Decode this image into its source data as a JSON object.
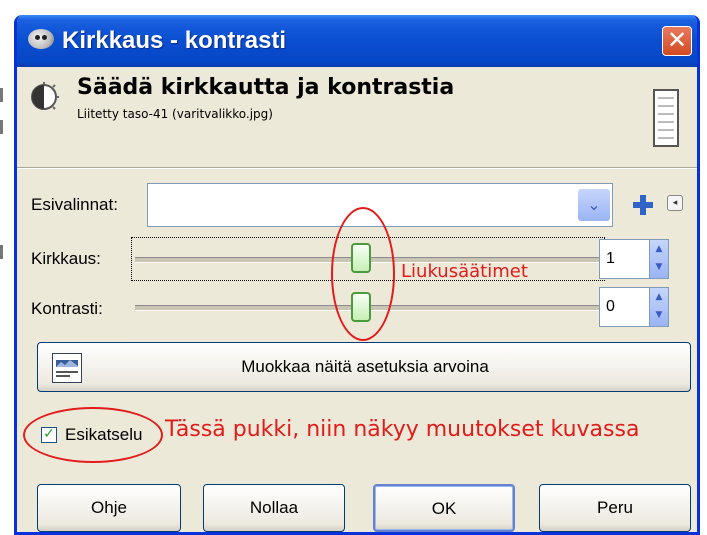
{
  "window": {
    "title": "Kirkkaus - kontrasti",
    "close_glyph": "✕"
  },
  "header": {
    "title": "Säädä kirkkautta ja kontrastia",
    "subtitle": "Liitetty taso-41 (varitvalikko.jpg)"
  },
  "presets": {
    "label": "Esivalinnat:",
    "value": "",
    "dropdown_glyph": "⌄",
    "menu_glyph": "◂"
  },
  "sliders": [
    {
      "label": "Kirkkaus:",
      "value": "1",
      "level": 0.5
    },
    {
      "label": "Kontrasti:",
      "value": "0",
      "level": 0.5
    }
  ],
  "edit_button": {
    "label": "Muokkaa näitä asetuksia arvoina"
  },
  "preview": {
    "label": "Esikatselu",
    "checked": true,
    "check_glyph": "✓"
  },
  "buttons": {
    "help": "Ohje",
    "reset": "Nollaa",
    "ok": "OK",
    "cancel": "Peru"
  },
  "annotations": {
    "sliders_note": "Liukusäätimet",
    "preview_note": "Tässä pukki, niin näkyy muutokset kuvassa"
  },
  "colors": {
    "annotation_red": "#e21b1b",
    "titlebar_blue": "#0a4ed0",
    "slider_thumb_green": "#4b9a3b"
  },
  "icons": {
    "app": "gimp-wilber-icon",
    "header": "contrast-icon",
    "add_preset": "plus-icon",
    "edit_settings": "settings-panel-icon"
  }
}
